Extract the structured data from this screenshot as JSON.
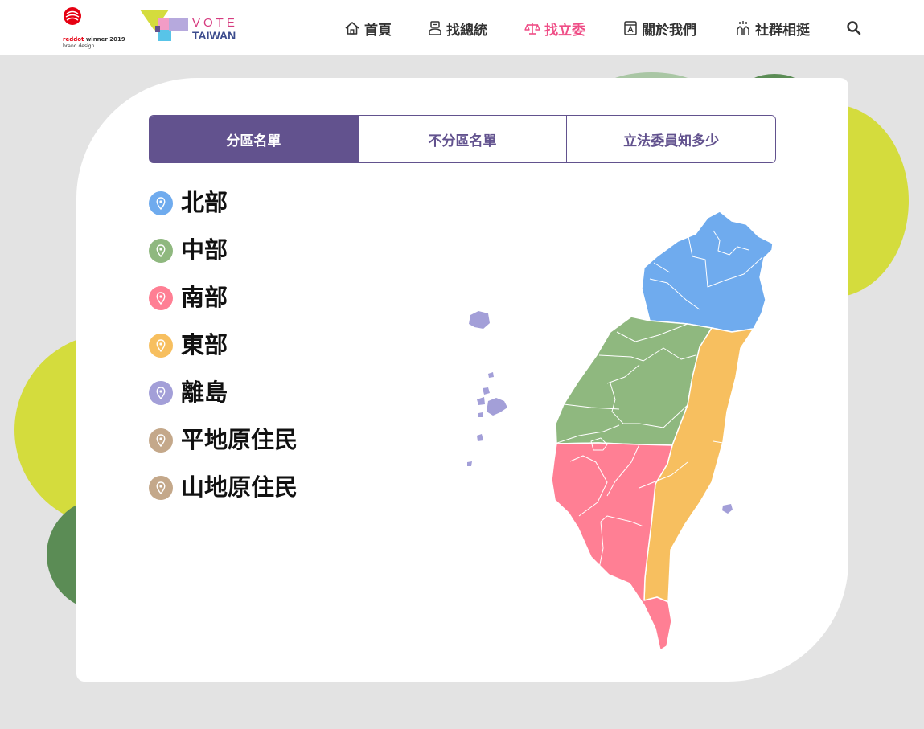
{
  "header": {
    "reddot": {
      "brand": "reddot",
      "award": "winner 2019",
      "category": "brand design"
    },
    "logo": {
      "line1": "VOTE",
      "line2": "TAIWAN"
    },
    "nav": [
      {
        "label": "首頁",
        "icon": "home-icon",
        "active": false
      },
      {
        "label": "找總統",
        "icon": "president-icon",
        "active": false
      },
      {
        "label": "找立委",
        "icon": "scale-icon",
        "active": true
      },
      {
        "label": "關於我們",
        "icon": "about-icon",
        "active": false
      },
      {
        "label": "社群相挺",
        "icon": "hands-icon",
        "active": false
      }
    ],
    "search_icon": "search-icon"
  },
  "tabs": [
    {
      "label": "分區名單",
      "active": true
    },
    {
      "label": "不分區名單",
      "active": false
    },
    {
      "label": "立法委員知多少",
      "active": false
    }
  ],
  "regions": [
    {
      "label": "北部",
      "color": "#6fabee"
    },
    {
      "label": "中部",
      "color": "#8fb87f"
    },
    {
      "label": "南部",
      "color": "#ff7f94"
    },
    {
      "label": "東部",
      "color": "#f7bf5f"
    },
    {
      "label": "離島",
      "color": "#a39fd8"
    },
    {
      "label": "平地原住民",
      "color": "#c4a88a"
    },
    {
      "label": "山地原住民",
      "color": "#c4a88a"
    }
  ],
  "colors": {
    "accent": "#ef4d86",
    "tab_purple": "#62528e",
    "north": "#6fabee",
    "central": "#8fb87f",
    "south": "#ff7f94",
    "east": "#f7bf5f",
    "islands": "#a39fd8",
    "aboriginal": "#c4a88a",
    "lime": "#d4dc3d",
    "green": "#5b8c55"
  }
}
